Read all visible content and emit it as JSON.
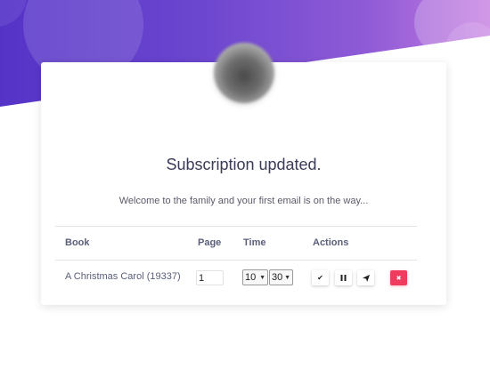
{
  "header": {
    "title": "Subscription updated.",
    "subtitle": "Welcome to the family and your first email is on the way..."
  },
  "table": {
    "columns": [
      "Book",
      "Page",
      "Time",
      "Actions"
    ],
    "rows": [
      {
        "book": "A Christmas Carol (19337)",
        "page": "1",
        "hour": "10",
        "minute": "30"
      }
    ]
  },
  "icons": {
    "confirm": "check-icon",
    "pause": "pause-icon",
    "send": "send-icon",
    "delete": "close-icon",
    "avatar": "avatar-image"
  },
  "colors": {
    "gradient_start": "#5533c7",
    "gradient_end": "#c57be0",
    "delete_button": "#ef3b5e",
    "title_text": "#3a3a5a"
  }
}
